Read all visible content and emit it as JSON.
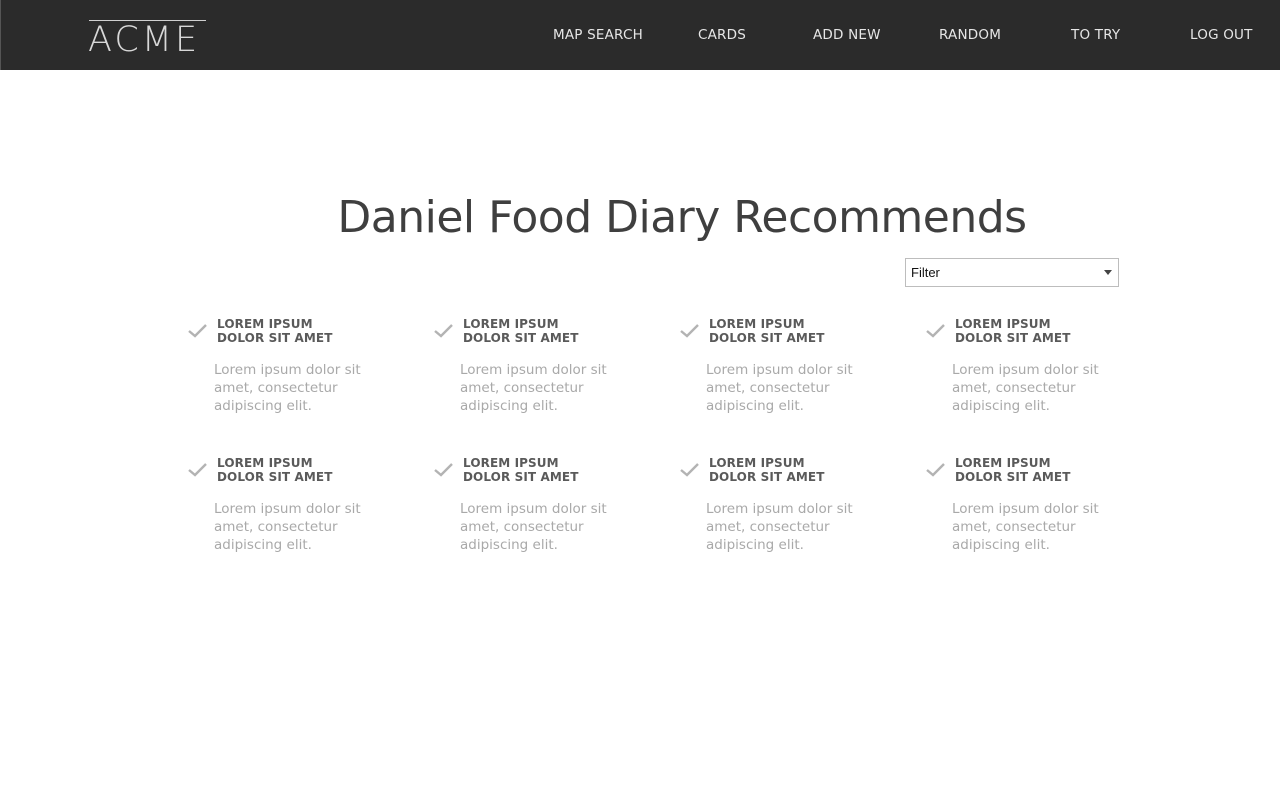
{
  "header": {
    "logo": "ACME",
    "nav": [
      "MAP SEARCH",
      "CARDS",
      "ADD NEW",
      "RANDOM",
      "TO TRY",
      "LOG OUT"
    ]
  },
  "main": {
    "title": "Daniel Food Diary Recommends",
    "filter": {
      "value": "Filter"
    },
    "items": [
      {
        "heading_1": "LOREM IPSUM",
        "heading_2": "DOLOR SIT AMET",
        "body": "Lorem ipsum dolor sit amet, consectetur adipiscing elit."
      },
      {
        "heading_1": "LOREM IPSUM",
        "heading_2": "DOLOR SIT AMET",
        "body": "Lorem ipsum dolor sit amet, consectetur adipiscing elit."
      },
      {
        "heading_1": "LOREM IPSUM",
        "heading_2": "DOLOR SIT AMET",
        "body": "Lorem ipsum dolor sit amet, consectetur adipiscing elit."
      },
      {
        "heading_1": "LOREM IPSUM",
        "heading_2": "DOLOR SIT AMET",
        "body": "Lorem ipsum dolor sit amet, consectetur adipiscing elit."
      },
      {
        "heading_1": "LOREM IPSUM",
        "heading_2": "DOLOR SIT AMET",
        "body": "Lorem ipsum dolor sit amet, consectetur adipiscing elit."
      },
      {
        "heading_1": "LOREM IPSUM",
        "heading_2": "DOLOR SIT AMET",
        "body": "Lorem ipsum dolor sit amet, consectetur adipiscing elit."
      },
      {
        "heading_1": "LOREM IPSUM",
        "heading_2": "DOLOR SIT AMET",
        "body": "Lorem ipsum dolor sit amet, consectetur adipiscing elit."
      },
      {
        "heading_1": "LOREM IPSUM",
        "heading_2": "DOLOR SIT AMET",
        "body": "Lorem ipsum dolor sit amet, consectetur adipiscing elit."
      }
    ]
  },
  "colors": {
    "header_bg": "#2b2b2b",
    "nav_text": "#e6e6e6",
    "title_text": "#3f3f3f",
    "heading_text": "#5a5a5a",
    "body_text": "#a9a9a9",
    "check_icon": "#b3b3b3"
  },
  "icons": {
    "item_icon": "check-icon",
    "filter_icon": "chevron-down-icon"
  }
}
